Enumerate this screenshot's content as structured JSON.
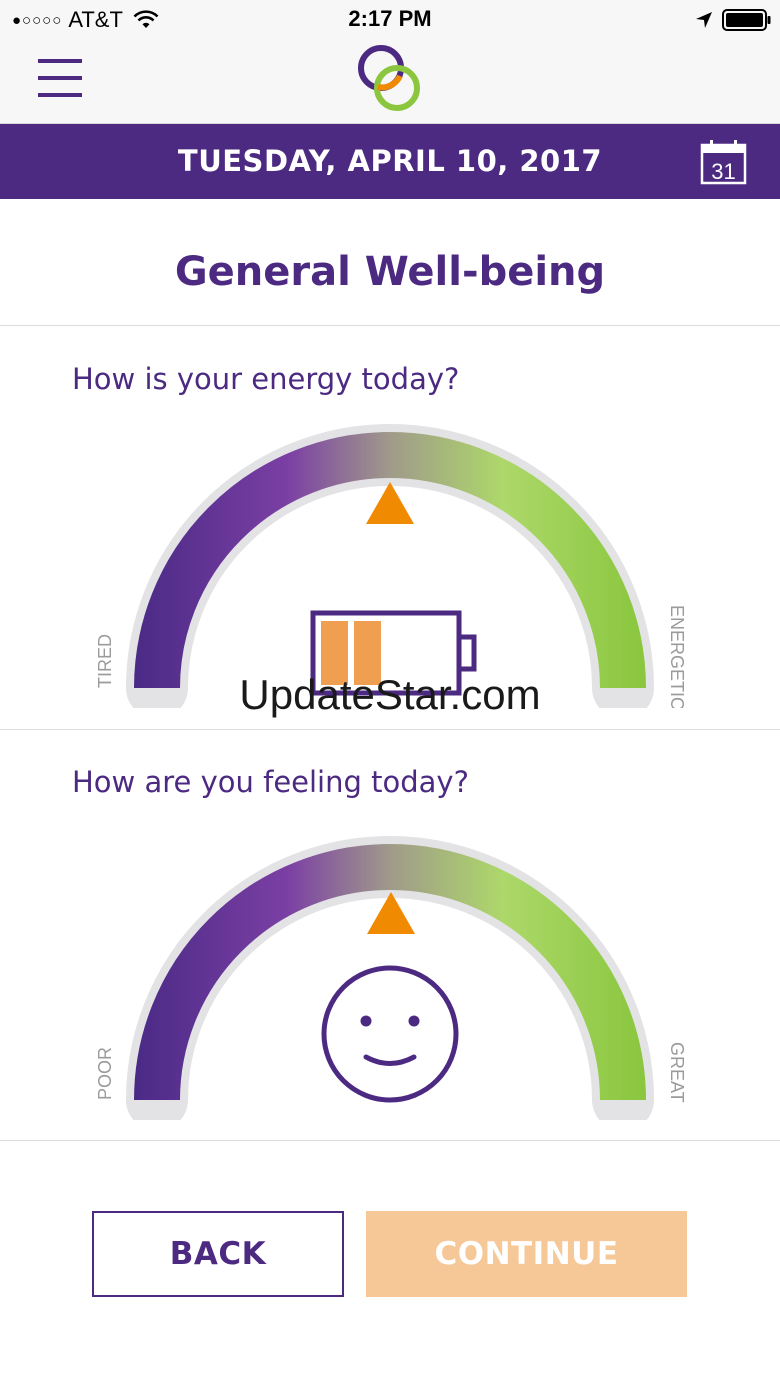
{
  "status_bar": {
    "carrier": "AT&T",
    "signal_dots": "●○○○○",
    "time": "2:17 PM"
  },
  "header": {
    "menu_icon": "hamburger-menu-icon",
    "logo": "app-logo-rings"
  },
  "date_bar": {
    "date": "TUESDAY, APRIL 10, 2017",
    "calendar_day": "31"
  },
  "page": {
    "title": "General Well-being"
  },
  "energy": {
    "question": "How is your energy today?",
    "min_label": "TIRED",
    "max_label": "ENERGETIC",
    "level": 0.5,
    "icon": "battery-icon",
    "battery_fill": 0.4
  },
  "feeling": {
    "question": "How are you feeling today?",
    "min_label": "POOR",
    "max_label": "GREAT",
    "level": 0.5,
    "icon": "smiley-face-icon"
  },
  "watermark": "UpdateStar.com",
  "buttons": {
    "back": "BACK",
    "continue": "CONTINUE"
  },
  "colors": {
    "brand_purple": "#4c2a82",
    "gauge_green": "#8cc63f",
    "pointer_orange": "#f08a00",
    "continue_disabled": "#f6c797"
  }
}
